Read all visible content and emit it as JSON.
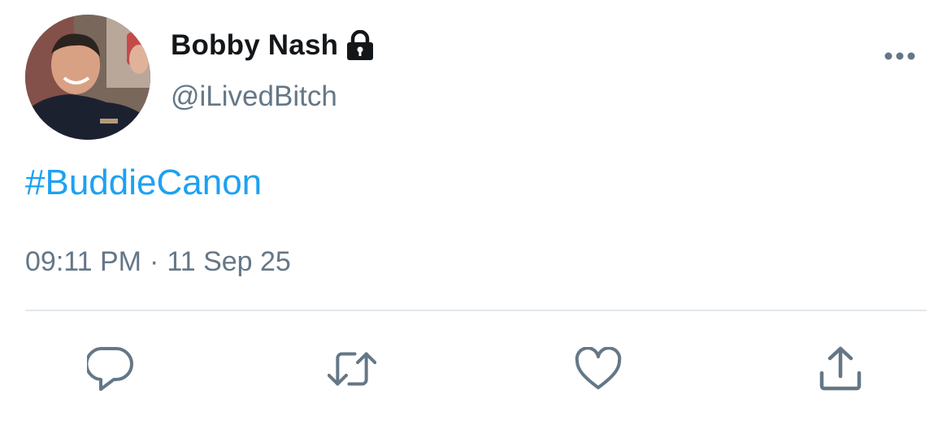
{
  "tweet": {
    "display_name": "Bobby Nash",
    "handle": "@iLivedBitch",
    "protected_icon": "lock-icon",
    "text": "#BuddieCanon",
    "time": "09:11 PM",
    "separator": "·",
    "date": "11 Sep 25"
  },
  "actions": {
    "reply": "reply-icon",
    "retweet": "retweet-icon",
    "like": "heart-icon",
    "share": "share-icon"
  },
  "colors": {
    "link": "#1da1f2",
    "secondary_text": "#657786",
    "primary_text": "#14171a",
    "divider": "#e1e8ed"
  }
}
